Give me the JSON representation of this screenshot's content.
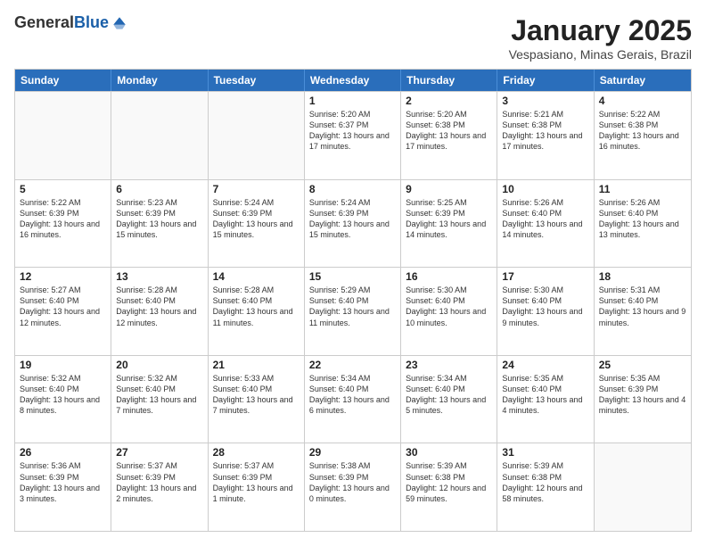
{
  "logo": {
    "general": "General",
    "blue": "Blue"
  },
  "header": {
    "title": "January 2025",
    "subtitle": "Vespasiano, Minas Gerais, Brazil"
  },
  "days": [
    "Sunday",
    "Monday",
    "Tuesday",
    "Wednesday",
    "Thursday",
    "Friday",
    "Saturday"
  ],
  "weeks": [
    [
      {
        "day": "",
        "empty": true
      },
      {
        "day": "",
        "empty": true
      },
      {
        "day": "",
        "empty": true
      },
      {
        "day": "1",
        "sunrise": "5:20 AM",
        "sunset": "6:37 PM",
        "daylight": "13 hours and 17 minutes."
      },
      {
        "day": "2",
        "sunrise": "5:20 AM",
        "sunset": "6:38 PM",
        "daylight": "13 hours and 17 minutes."
      },
      {
        "day": "3",
        "sunrise": "5:21 AM",
        "sunset": "6:38 PM",
        "daylight": "13 hours and 17 minutes."
      },
      {
        "day": "4",
        "sunrise": "5:22 AM",
        "sunset": "6:38 PM",
        "daylight": "13 hours and 16 minutes."
      }
    ],
    [
      {
        "day": "5",
        "sunrise": "5:22 AM",
        "sunset": "6:39 PM",
        "daylight": "13 hours and 16 minutes."
      },
      {
        "day": "6",
        "sunrise": "5:23 AM",
        "sunset": "6:39 PM",
        "daylight": "13 hours and 15 minutes."
      },
      {
        "day": "7",
        "sunrise": "5:24 AM",
        "sunset": "6:39 PM",
        "daylight": "13 hours and 15 minutes."
      },
      {
        "day": "8",
        "sunrise": "5:24 AM",
        "sunset": "6:39 PM",
        "daylight": "13 hours and 15 minutes."
      },
      {
        "day": "9",
        "sunrise": "5:25 AM",
        "sunset": "6:39 PM",
        "daylight": "13 hours and 14 minutes."
      },
      {
        "day": "10",
        "sunrise": "5:26 AM",
        "sunset": "6:40 PM",
        "daylight": "13 hours and 14 minutes."
      },
      {
        "day": "11",
        "sunrise": "5:26 AM",
        "sunset": "6:40 PM",
        "daylight": "13 hours and 13 minutes."
      }
    ],
    [
      {
        "day": "12",
        "sunrise": "5:27 AM",
        "sunset": "6:40 PM",
        "daylight": "13 hours and 12 minutes."
      },
      {
        "day": "13",
        "sunrise": "5:28 AM",
        "sunset": "6:40 PM",
        "daylight": "13 hours and 12 minutes."
      },
      {
        "day": "14",
        "sunrise": "5:28 AM",
        "sunset": "6:40 PM",
        "daylight": "13 hours and 11 minutes."
      },
      {
        "day": "15",
        "sunrise": "5:29 AM",
        "sunset": "6:40 PM",
        "daylight": "13 hours and 11 minutes."
      },
      {
        "day": "16",
        "sunrise": "5:30 AM",
        "sunset": "6:40 PM",
        "daylight": "13 hours and 10 minutes."
      },
      {
        "day": "17",
        "sunrise": "5:30 AM",
        "sunset": "6:40 PM",
        "daylight": "13 hours and 9 minutes."
      },
      {
        "day": "18",
        "sunrise": "5:31 AM",
        "sunset": "6:40 PM",
        "daylight": "13 hours and 9 minutes."
      }
    ],
    [
      {
        "day": "19",
        "sunrise": "5:32 AM",
        "sunset": "6:40 PM",
        "daylight": "13 hours and 8 minutes."
      },
      {
        "day": "20",
        "sunrise": "5:32 AM",
        "sunset": "6:40 PM",
        "daylight": "13 hours and 7 minutes."
      },
      {
        "day": "21",
        "sunrise": "5:33 AM",
        "sunset": "6:40 PM",
        "daylight": "13 hours and 7 minutes."
      },
      {
        "day": "22",
        "sunrise": "5:34 AM",
        "sunset": "6:40 PM",
        "daylight": "13 hours and 6 minutes."
      },
      {
        "day": "23",
        "sunrise": "5:34 AM",
        "sunset": "6:40 PM",
        "daylight": "13 hours and 5 minutes."
      },
      {
        "day": "24",
        "sunrise": "5:35 AM",
        "sunset": "6:40 PM",
        "daylight": "13 hours and 4 minutes."
      },
      {
        "day": "25",
        "sunrise": "5:35 AM",
        "sunset": "6:39 PM",
        "daylight": "13 hours and 4 minutes."
      }
    ],
    [
      {
        "day": "26",
        "sunrise": "5:36 AM",
        "sunset": "6:39 PM",
        "daylight": "13 hours and 3 minutes."
      },
      {
        "day": "27",
        "sunrise": "5:37 AM",
        "sunset": "6:39 PM",
        "daylight": "13 hours and 2 minutes."
      },
      {
        "day": "28",
        "sunrise": "5:37 AM",
        "sunset": "6:39 PM",
        "daylight": "13 hours and 1 minute."
      },
      {
        "day": "29",
        "sunrise": "5:38 AM",
        "sunset": "6:39 PM",
        "daylight": "13 hours and 0 minutes."
      },
      {
        "day": "30",
        "sunrise": "5:39 AM",
        "sunset": "6:38 PM",
        "daylight": "12 hours and 59 minutes."
      },
      {
        "day": "31",
        "sunrise": "5:39 AM",
        "sunset": "6:38 PM",
        "daylight": "12 hours and 58 minutes."
      },
      {
        "day": "",
        "empty": true
      }
    ]
  ]
}
